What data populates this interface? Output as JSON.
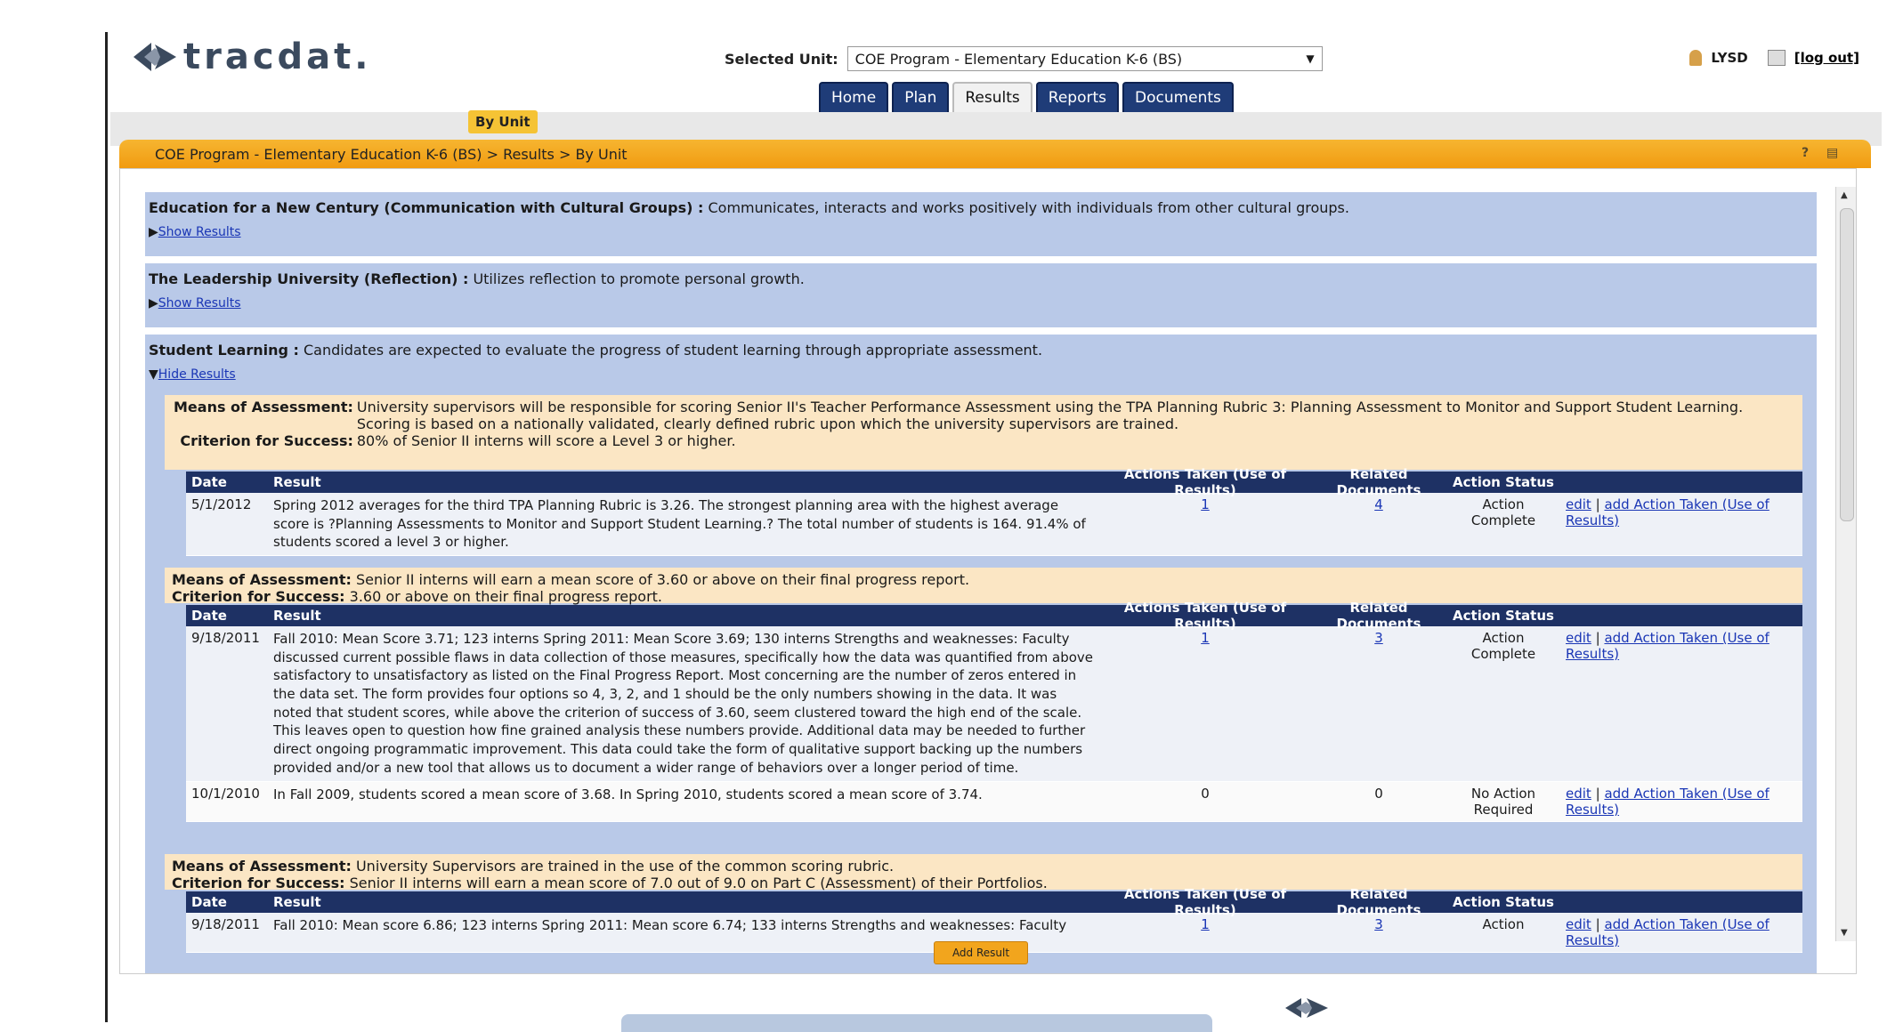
{
  "header": {
    "logo_text": "tracdat.",
    "selected_unit_label": "Selected Unit:",
    "selected_unit_value": "COE Program - Elementary Education K-6 (BS)",
    "user": "LYSD",
    "logout": "[log out]"
  },
  "tabs": [
    {
      "label": "Home"
    },
    {
      "label": "Plan"
    },
    {
      "label": "Results",
      "active": true
    },
    {
      "label": "Reports"
    },
    {
      "label": "Documents"
    }
  ],
  "subtab": "By Unit",
  "breadcrumb": "COE Program - Elementary Education K-6 (BS) > Results > By Unit",
  "outcomes": [
    {
      "title": "Education for a New Century (Communication with Cultural Groups) :",
      "desc": " Communicates, interacts and works positively with individuals from other cultural groups.",
      "toggle": "Show Results"
    },
    {
      "title": "The Leadership University (Reflection) :",
      "desc": " Utilizes reflection to promote personal growth.",
      "toggle": "Show Results"
    },
    {
      "title": "Student Learning :",
      "desc": " Candidates are expected to evaluate the progress of student learning through appropriate assessment.",
      "toggle": "Hide Results"
    }
  ],
  "columns": {
    "date": "Date",
    "result": "Result",
    "actions": "Actions Taken (Use of Results)",
    "docs": "Related Documents",
    "status": "Action Status"
  },
  "links": {
    "edit": "edit",
    "sep": "|",
    "add_action": "add Action Taken (Use of Results)"
  },
  "assessments": [
    {
      "means_label": "Means of Assessment:",
      "means": "University supervisors will be responsible for scoring Senior II's Teacher Performance Assessment using the TPA Planning Rubric 3: Planning Assessment to Monitor and Support Student Learning. Scoring is based on a nationally validated, clearly defined rubric upon which the university supervisors are trained.",
      "criterion_label": "Criterion for Success:",
      "criterion": "80% of Senior II interns will score a Level 3 or higher.",
      "rows": [
        {
          "date": "5/1/2012",
          "result": "Spring 2012 averages for the third TPA Planning Rubric is 3.26. The strongest planning area with the highest average score is ?Planning Assessments to Monitor and Support Student Learning.? The total number of students is 164. 91.4% of students scored a level 3 or higher.",
          "actions": "1",
          "docs": "4",
          "status": "Action Complete"
        }
      ]
    },
    {
      "means_label": "Means of Assessment:",
      "means": "Senior II interns will earn a mean score of 3.60 or above on their final progress report.",
      "criterion_label": "Criterion for Success:",
      "criterion": "3.60 or above on their final progress report.",
      "rows": [
        {
          "date": "9/18/2011",
          "result": "Fall 2010: Mean Score 3.71; 123 interns Spring 2011: Mean Score 3.69; 130 interns Strengths and weaknesses: Faculty discussed current possible flaws in data collection of those measures, specifically how the data was quantified from above satisfactory to unsatisfactory as listed on the Final Progress Report. Most concerning are the number of zeros entered in the data set. The form provides four options so 4, 3, 2, and 1 should be the only numbers showing in the data. It was noted that student scores, while above the criterion of success of 3.60, seem clustered toward the high end of the scale. This leaves open to question how fine grained analysis these numbers provide. Additional data may be needed to further direct ongoing programmatic improvement. This data could take the form of qualitative support backing up the numbers provided and/or a new tool that allows us to document a wider range of behaviors over a longer period of time.",
          "actions": "1",
          "docs": "3",
          "status": "Action Complete"
        },
        {
          "date": "10/1/2010",
          "result": "In Fall 2009, students scored a mean score of 3.68. In Spring 2010, students scored a mean score of 3.74.",
          "actions": "0",
          "docs": "0",
          "status": "No Action Required"
        }
      ]
    },
    {
      "means_label": "Means of Assessment:",
      "means": "University Supervisors are trained in the use of the common scoring rubric.",
      "criterion_label": "Criterion for Success:",
      "criterion": "Senior II interns will earn a mean score of 7.0 out of 9.0 on Part C (Assessment) of their Portfolios.",
      "rows": [
        {
          "date": "9/18/2011",
          "result": "Fall 2010: Mean score 6.86; 123 interns Spring 2011: Mean score 6.74; 133 interns Strengths and weaknesses: Faculty",
          "actions": "1",
          "docs": "3",
          "status": "Action"
        }
      ]
    }
  ],
  "add_result": "Add Result"
}
